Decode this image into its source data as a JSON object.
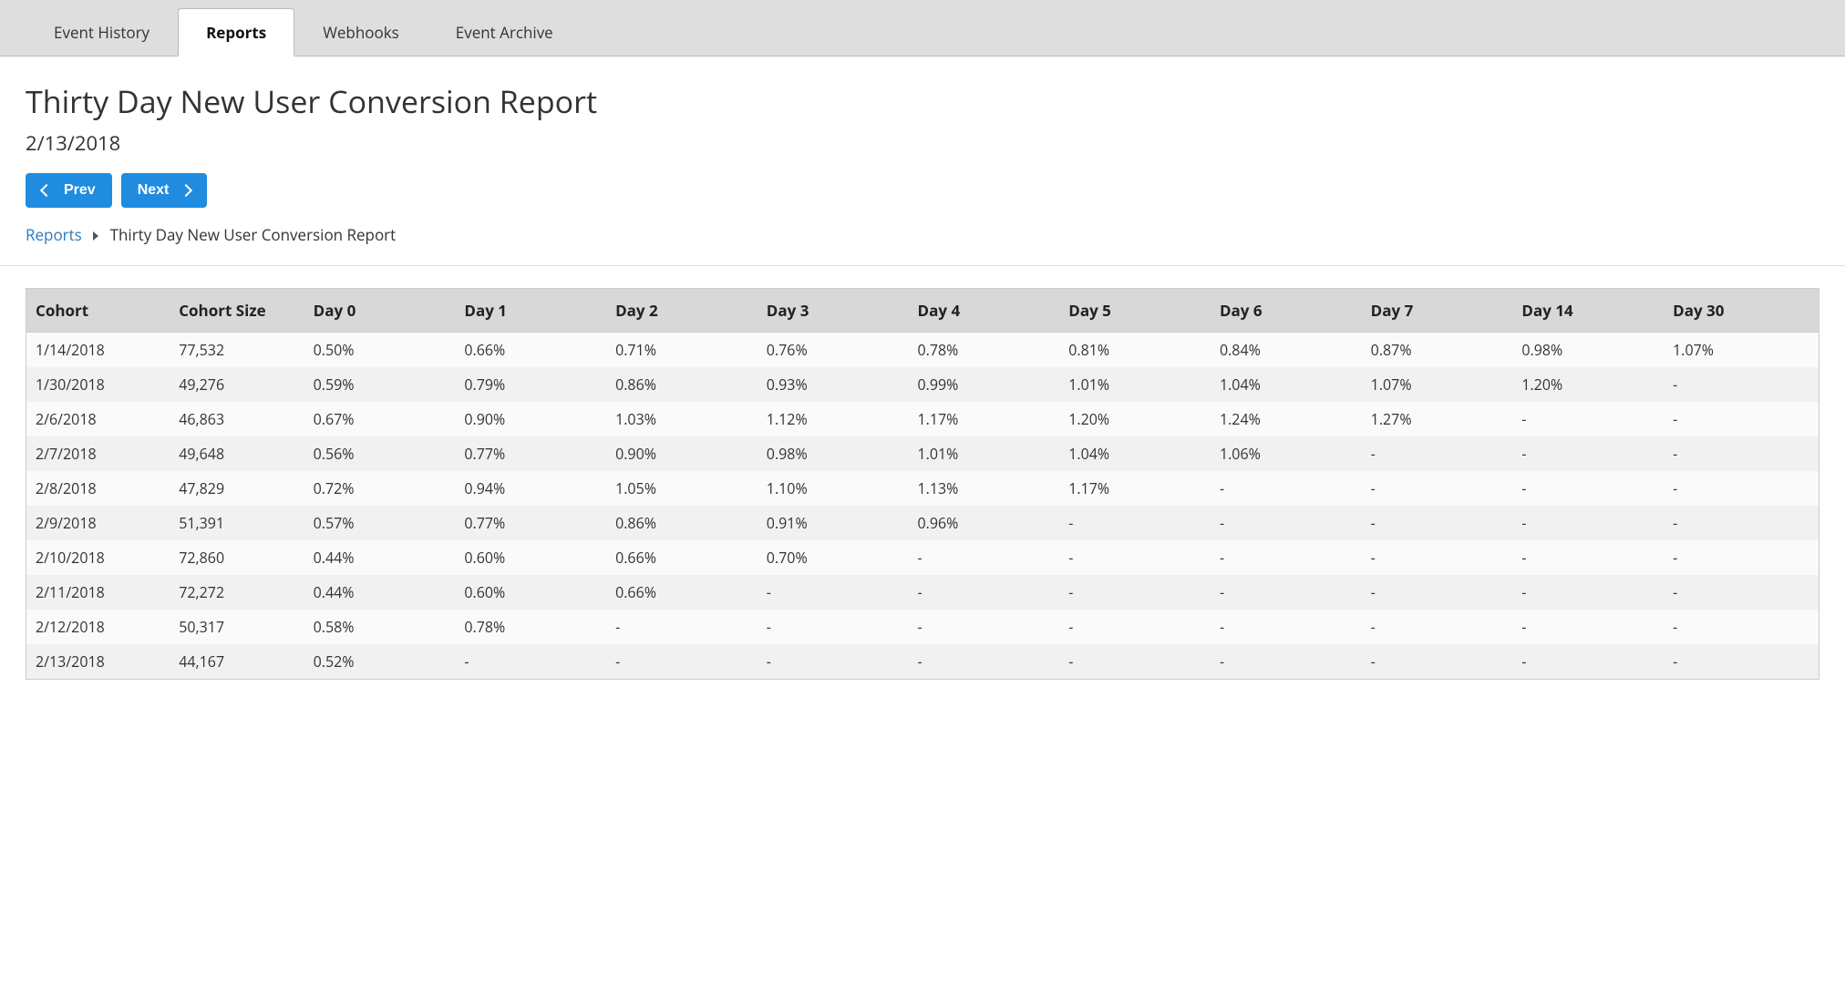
{
  "tabs": [
    {
      "label": "Event History",
      "active": false
    },
    {
      "label": "Reports",
      "active": true
    },
    {
      "label": "Webhooks",
      "active": false
    },
    {
      "label": "Event Archive",
      "active": false
    }
  ],
  "page": {
    "title": "Thirty Day New User Conversion Report",
    "date": "2/13/2018"
  },
  "buttons": {
    "prev": "Prev",
    "next": "Next"
  },
  "breadcrumb": {
    "root": "Reports",
    "current": "Thirty Day New User Conversion Report"
  },
  "table": {
    "headers": [
      "Cohort",
      "Cohort Size",
      "Day 0",
      "Day 1",
      "Day 2",
      "Day 3",
      "Day 4",
      "Day 5",
      "Day 6",
      "Day 7",
      "Day 14",
      "Day 30"
    ],
    "rows": [
      [
        "1/14/2018",
        "77,532",
        "0.50%",
        "0.66%",
        "0.71%",
        "0.76%",
        "0.78%",
        "0.81%",
        "0.84%",
        "0.87%",
        "0.98%",
        "1.07%"
      ],
      [
        "1/30/2018",
        "49,276",
        "0.59%",
        "0.79%",
        "0.86%",
        "0.93%",
        "0.99%",
        "1.01%",
        "1.04%",
        "1.07%",
        "1.20%",
        "-"
      ],
      [
        "2/6/2018",
        "46,863",
        "0.67%",
        "0.90%",
        "1.03%",
        "1.12%",
        "1.17%",
        "1.20%",
        "1.24%",
        "1.27%",
        "-",
        "-"
      ],
      [
        "2/7/2018",
        "49,648",
        "0.56%",
        "0.77%",
        "0.90%",
        "0.98%",
        "1.01%",
        "1.04%",
        "1.06%",
        "-",
        "-",
        "-"
      ],
      [
        "2/8/2018",
        "47,829",
        "0.72%",
        "0.94%",
        "1.05%",
        "1.10%",
        "1.13%",
        "1.17%",
        "-",
        "-",
        "-",
        "-"
      ],
      [
        "2/9/2018",
        "51,391",
        "0.57%",
        "0.77%",
        "0.86%",
        "0.91%",
        "0.96%",
        "-",
        "-",
        "-",
        "-",
        "-"
      ],
      [
        "2/10/2018",
        "72,860",
        "0.44%",
        "0.60%",
        "0.66%",
        "0.70%",
        "-",
        "-",
        "-",
        "-",
        "-",
        "-"
      ],
      [
        "2/11/2018",
        "72,272",
        "0.44%",
        "0.60%",
        "0.66%",
        "-",
        "-",
        "-",
        "-",
        "-",
        "-",
        "-"
      ],
      [
        "2/12/2018",
        "50,317",
        "0.58%",
        "0.78%",
        "-",
        "-",
        "-",
        "-",
        "-",
        "-",
        "-",
        "-"
      ],
      [
        "2/13/2018",
        "44,167",
        "0.52%",
        "-",
        "-",
        "-",
        "-",
        "-",
        "-",
        "-",
        "-",
        "-"
      ]
    ]
  }
}
